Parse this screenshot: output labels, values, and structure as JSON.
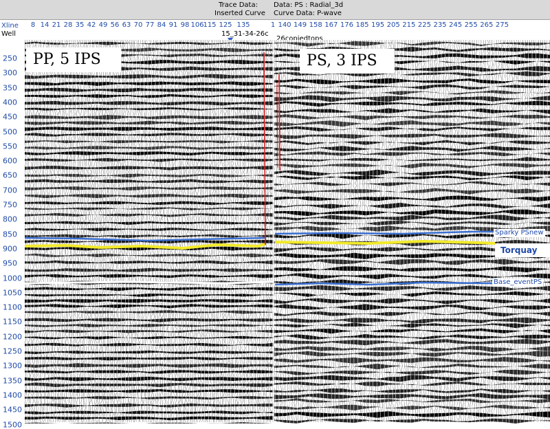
{
  "header": {
    "trace_data_title": "Trace Data:",
    "data_text": "Data: PS : Radial_3d",
    "inserted_curve": "Inserted Curve",
    "curve_data": "Curve Data:  P-wave"
  },
  "axis_labels": {
    "xline": "Xline",
    "well": "Well"
  },
  "xline_ticks": [
    "8",
    "14",
    "21",
    "28",
    "35",
    "42",
    "49",
    "56",
    "63",
    "70",
    "77",
    "84",
    "91",
    "98",
    "106",
    "115",
    "125",
    "135",
    "1",
    "140",
    "149",
    "158",
    "167",
    "176",
    "185",
    "195",
    "205",
    "215",
    "225",
    "235",
    "245",
    "255",
    "265",
    "275"
  ],
  "time_ticks": [
    "250",
    "300",
    "350",
    "400",
    "450",
    "500",
    "550",
    "600",
    "650",
    "700",
    "750",
    "800",
    "850",
    "900",
    "950",
    "1000",
    "1050",
    "1100",
    "1150",
    "1200",
    "1250",
    "1300",
    "1350",
    "1400",
    "1450",
    "1500"
  ],
  "wells": {
    "left_name": "15_31-34-26c",
    "right_name": "26copiedtops"
  },
  "panels": {
    "pp_label": "PP, 5 IPS",
    "ps_label": "PS, 3 IPS"
  },
  "horizons": {
    "sparky": "Sparky PSnew",
    "torquay": "Torquay",
    "base_event": "Base_eventPS"
  },
  "colors": {
    "xline_text": "#1f4aa8",
    "horizon_blue": "#3a6fd1",
    "torquay_yellow": "#f2ea2a",
    "white_horizon": "#ffffff",
    "well_red": "#d81e1e",
    "seismic_black": "#000000",
    "header_bg": "#d9d9d9"
  }
}
